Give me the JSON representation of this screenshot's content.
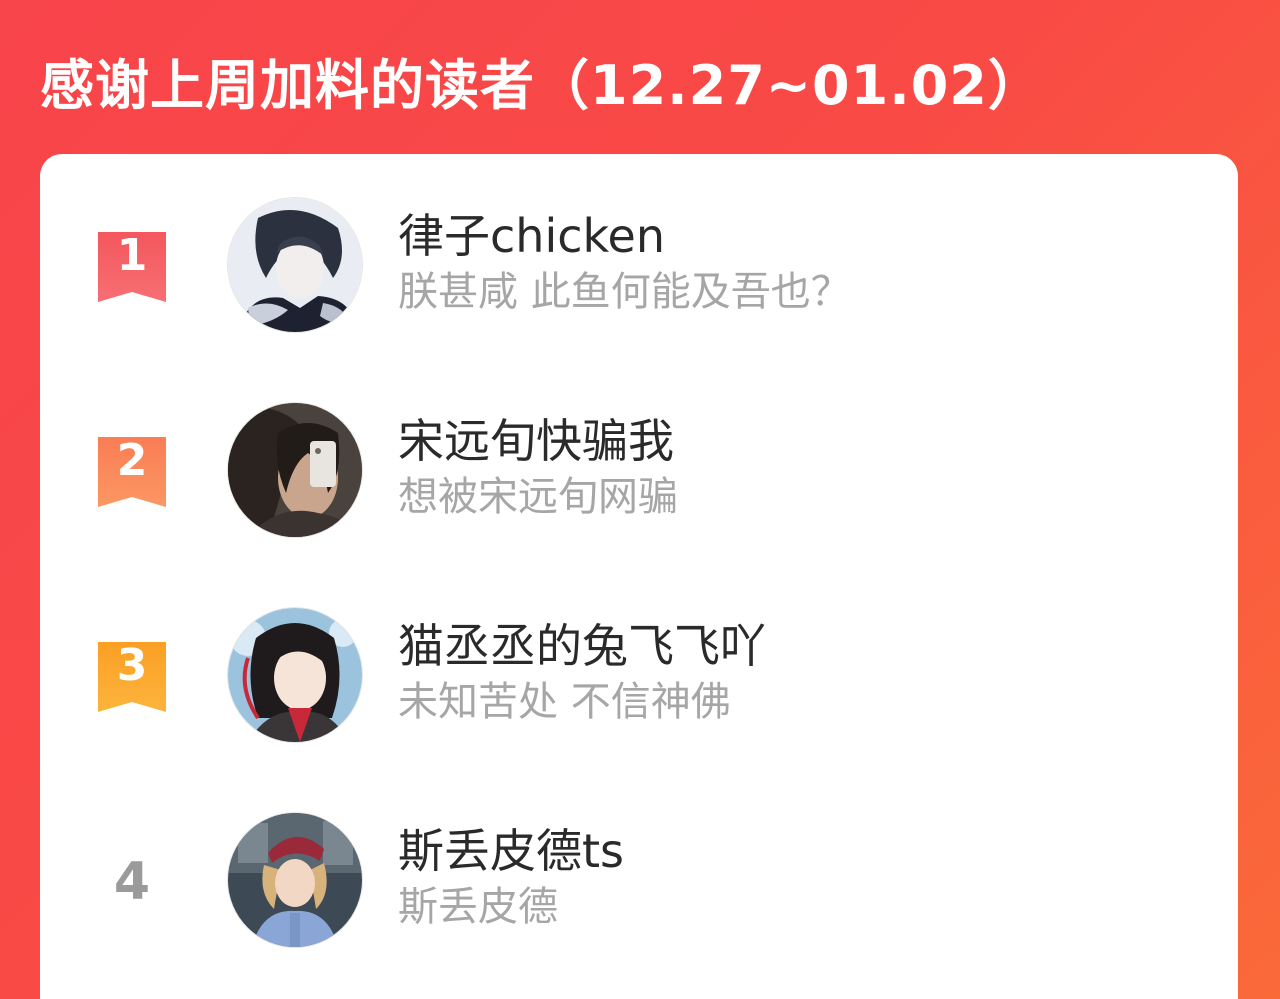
{
  "header": {
    "title": "感谢上周加料的读者（12.27~01.02）"
  },
  "colors": {
    "rank1": "#f45a5f",
    "rank2": "#fa8656",
    "rank3": "#fba52b",
    "rank_plain": "#9a9a9a",
    "background_start": "#f8444b",
    "background_end": "#fa6a39"
  },
  "readers": [
    {
      "rank": "1",
      "name": "律子chicken",
      "subtitle": "朕甚咸 此鱼何能及吾也？",
      "avatar": "avatar-anime-man-icon"
    },
    {
      "rank": "2",
      "name": "宋远旬快骗我",
      "subtitle": "想被宋远旬网骗",
      "avatar": "avatar-mirror-selfie-icon"
    },
    {
      "rank": "3",
      "name": "猫丞丞的兔飞飞吖",
      "subtitle": "未知苦处 不信神佛",
      "avatar": "avatar-anime-girl-icon"
    },
    {
      "rank": "4",
      "name": "斯丢皮德ts",
      "subtitle": "斯丢皮德",
      "avatar": "avatar-photo-woman-icon"
    }
  ]
}
